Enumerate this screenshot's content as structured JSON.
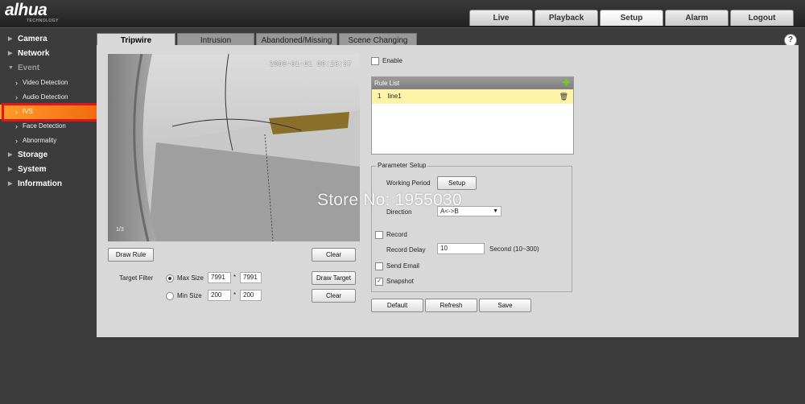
{
  "brand": {
    "logo": "alhua",
    "tagline": "TECHNOLOGY"
  },
  "nav": {
    "tabs": [
      {
        "label": "Live"
      },
      {
        "label": "Playback"
      },
      {
        "label": "Setup",
        "active": true
      },
      {
        "label": "Alarm"
      },
      {
        "label": "Logout"
      }
    ]
  },
  "sidebar": {
    "camera": "Camera",
    "network": "Network",
    "event": "Event",
    "video_detection": "Video Detection",
    "audio_detection": "Audio Detection",
    "ivs": "IVS",
    "face_detection": "Face Detection",
    "abnormality": "Abnormality",
    "storage": "Storage",
    "system": "System",
    "information": "Information"
  },
  "content_tabs": {
    "tripwire": "Tripwire",
    "intrusion": "Intrusion",
    "abandoned": "Abandoned/Missing",
    "scene": "Scene Changing"
  },
  "video": {
    "timestamp": "2000-01-01 00:26:37",
    "corner_text": "1/3"
  },
  "buttons": {
    "draw_rule": "Draw Rule",
    "clear": "Clear",
    "draw_target": "Draw Target",
    "clear2": "Clear",
    "setup": "Setup",
    "default": "Default",
    "refresh": "Refresh",
    "save": "Save"
  },
  "target_filter": {
    "label": "Target Filter",
    "max_label": "Max Size",
    "max_w": "7991",
    "max_h": "7991",
    "min_label": "Min Size",
    "min_w": "200",
    "min_h": "200",
    "sep": "*"
  },
  "enable": {
    "label": "Enable",
    "checked": false
  },
  "rule_list": {
    "title": "Rule List",
    "rows": [
      {
        "index": "1",
        "name": "line1"
      }
    ]
  },
  "params": {
    "legend": "Parameter Setup",
    "working_period": "Working Period",
    "direction_label": "Direction",
    "direction_value": "A<->B",
    "record": "Record",
    "record_delay_label": "Record Delay",
    "record_delay_value": "10",
    "record_delay_unit": "Second (10~300)",
    "send_email": "Send Email",
    "snapshot": "Snapshot",
    "snapshot_checked": true
  },
  "watermark": "Store No: 1955030"
}
